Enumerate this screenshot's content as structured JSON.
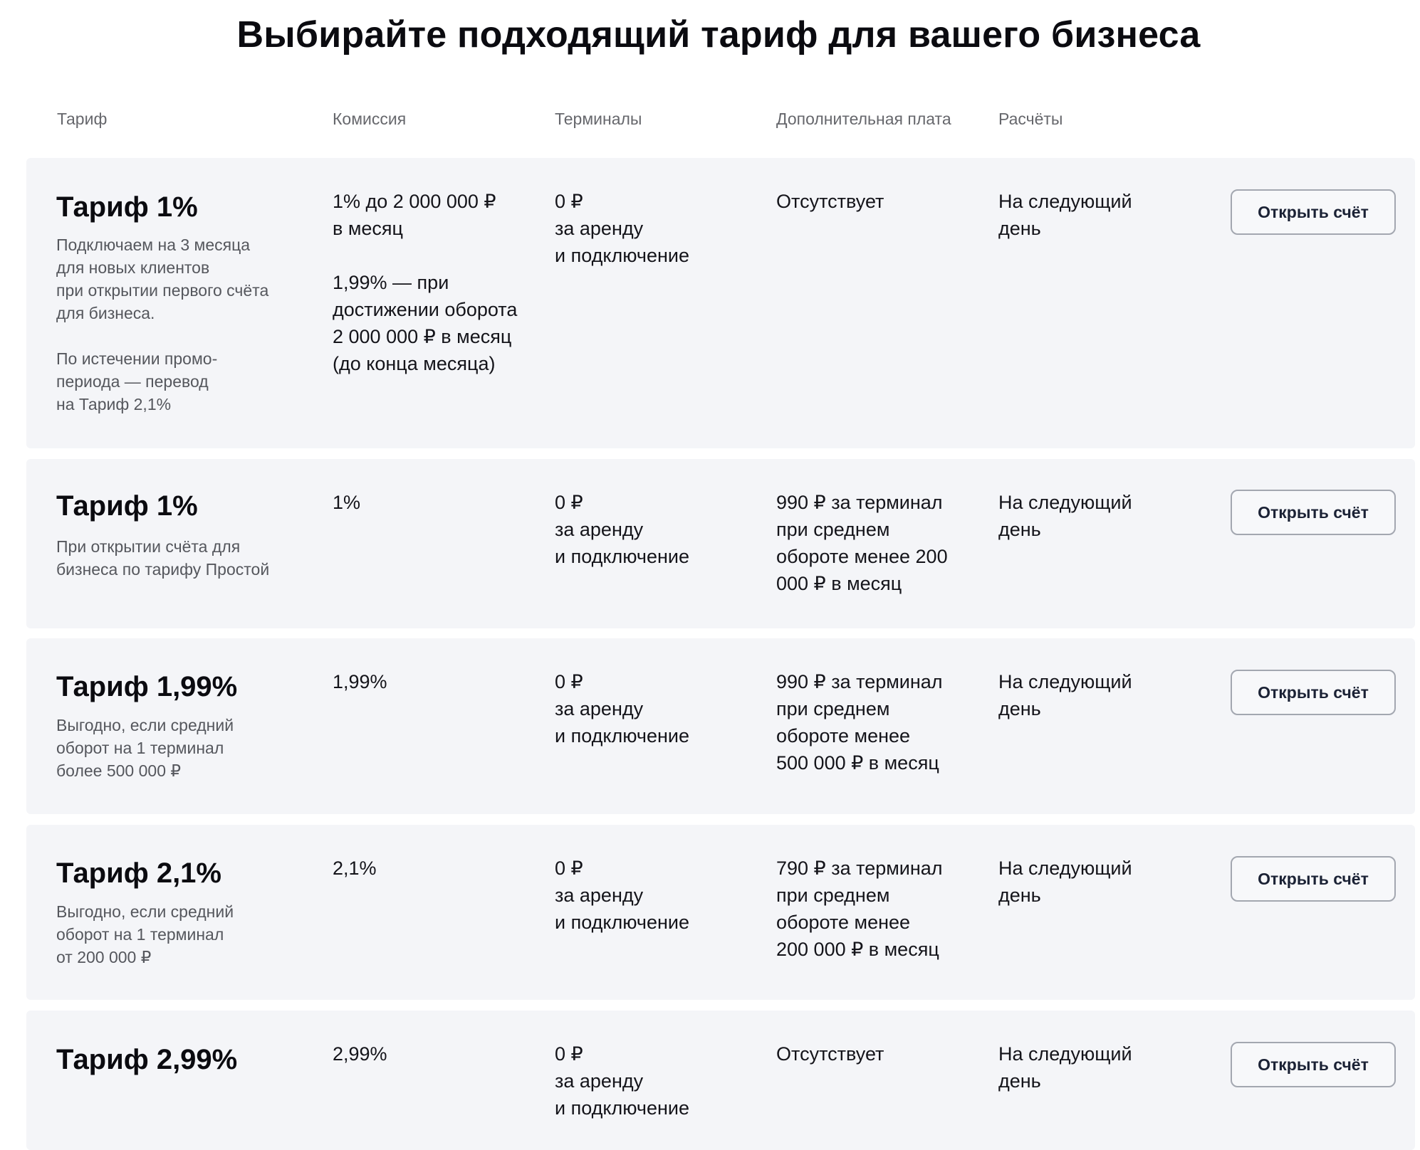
{
  "title": "Выбирайте подходящий тариф для вашего бизнеса",
  "columns": {
    "tariff": "Тариф",
    "commission": "Комиссия",
    "terminals": "Терминалы",
    "extra_fee": "Дополнительная плата",
    "settlements": "Расчёты"
  },
  "rows": [
    {
      "name": "Тариф 1%",
      "description": "Подключаем на 3 месяца\nдля новых клиентов\nпри открытии первого счёта\nдля бизнеса.\n\nПо истечении промо-\nпериода — перевод\nна Тариф 2,1%",
      "commission": "1% до 2 000 000 ₽\nв месяц\n\n1,99% — при\nдостижении оборота\n2 000 000 ₽ в месяц\n(до конца месяца)",
      "terminals": "0 ₽\nза аренду\nи подключение",
      "extra_fee": "Отсутствует",
      "settlements": "На следующий\nдень",
      "button": "Открыть счёт"
    },
    {
      "name": "Тариф 1%",
      "description": "При открытии счёта для\nбизнеса по тарифу Простой",
      "commission": "1%",
      "terminals": "0 ₽\nза аренду\nи подключение",
      "extra_fee": "990 ₽ за терминал\nпри среднем\nобороте менее 200\n000 ₽ в месяц",
      "settlements": "На следующий\nдень",
      "button": "Открыть счёт"
    },
    {
      "name": "Тариф 1,99%",
      "description": "Выгодно, если средний\nоборот на 1 терминал\nболее 500 000 ₽",
      "commission": "1,99%",
      "terminals": "0 ₽\nза аренду\nи подключение",
      "extra_fee": "990 ₽ за терминал\nпри среднем\nобороте менее\n500 000 ₽ в месяц",
      "settlements": "На следующий\nдень",
      "button": "Открыть счёт"
    },
    {
      "name": "Тариф 2,1%",
      "description": "Выгодно, если средний\nоборот на 1 терминал\nот 200 000 ₽",
      "commission": "2,1%",
      "terminals": "0 ₽\nза аренду\nи подключение",
      "extra_fee": "790 ₽ за терминал\nпри среднем\nобороте менее\n200 000 ₽ в месяц",
      "settlements": "На следующий\nдень",
      "button": "Открыть счёт"
    },
    {
      "name": "Тариф 2,99%",
      "description": "",
      "commission": "2,99%",
      "terminals": "0 ₽\nза аренду\nи подключение",
      "extra_fee": "Отсутствует",
      "settlements": "На следующий\nдень",
      "button": "Открыть счёт"
    }
  ]
}
